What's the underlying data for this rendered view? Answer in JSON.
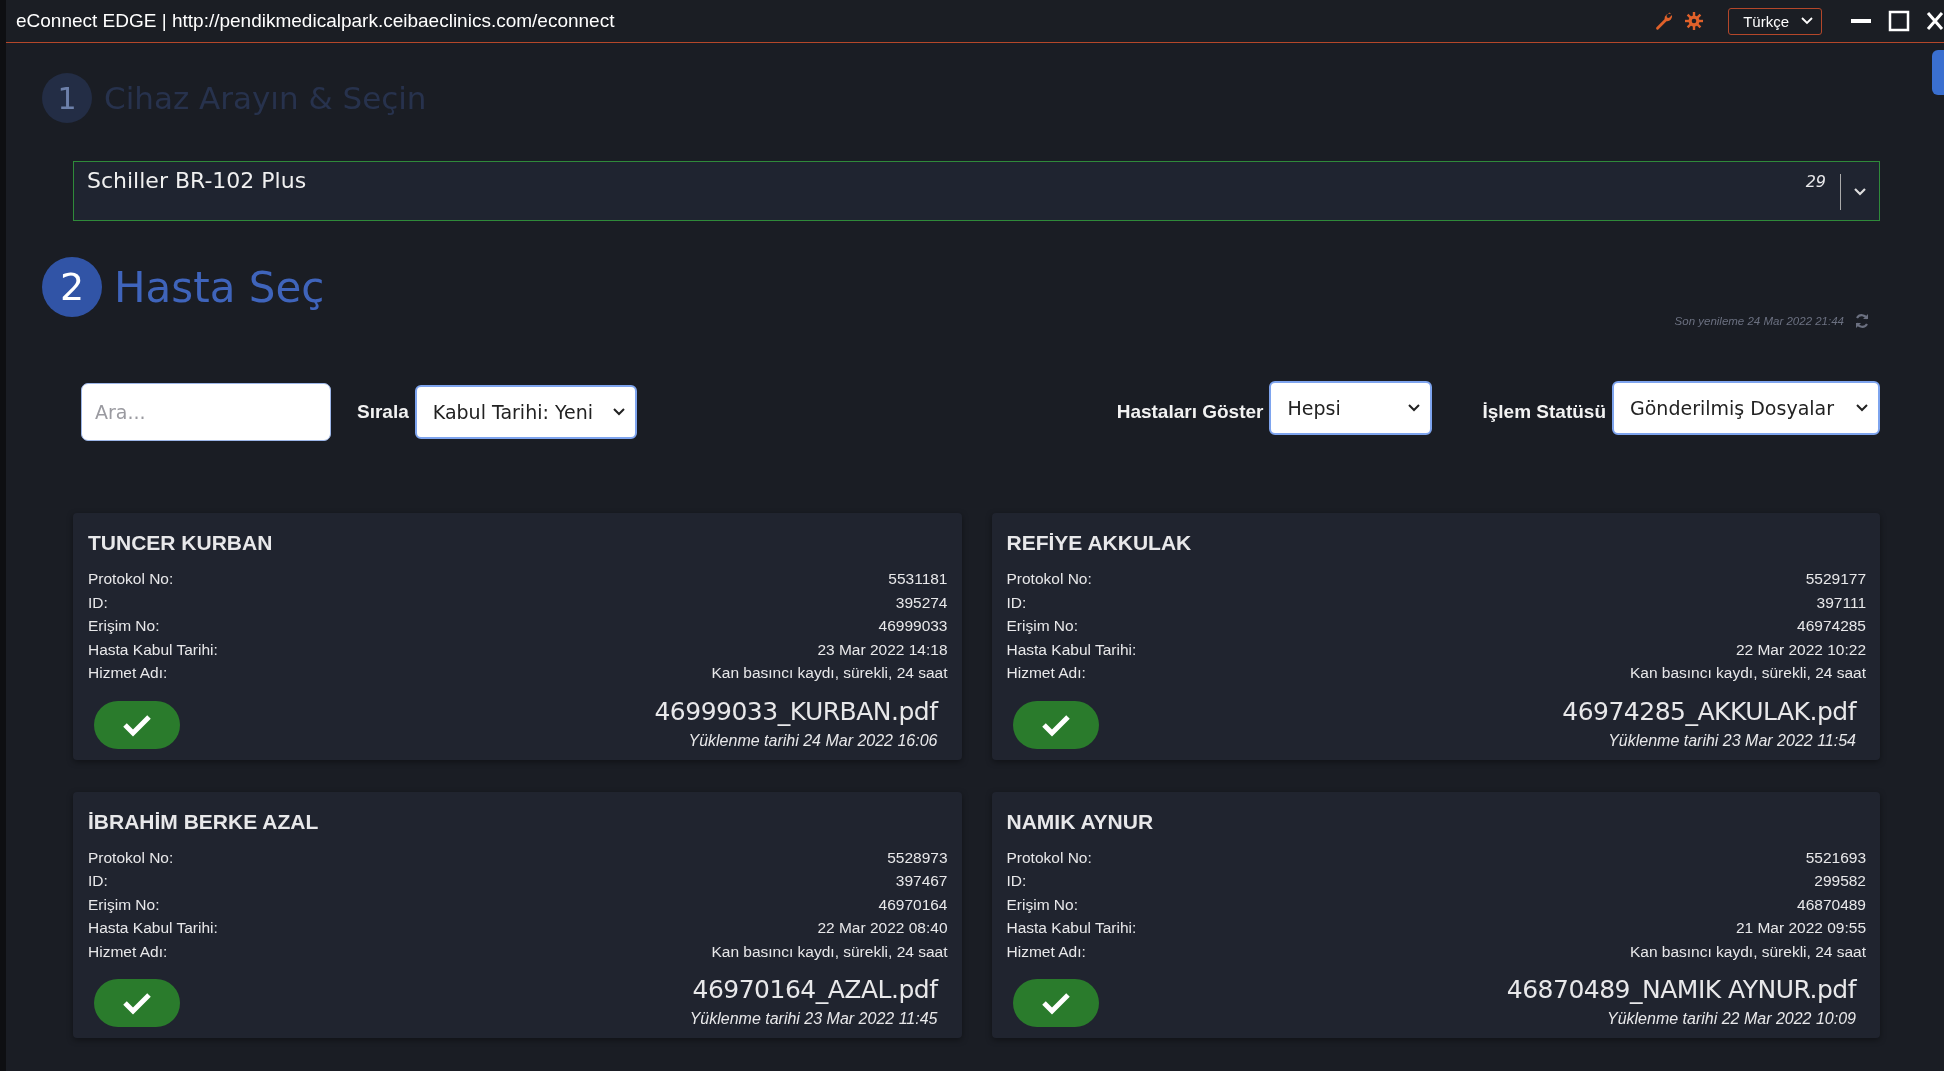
{
  "window": {
    "title": "eConnect EDGE | http://pendikmedicalpark.ceibaeclinics.com/econnect",
    "language": "Türkçe"
  },
  "steps": [
    {
      "number": "1",
      "title": "Cihaz Arayın & Seçin",
      "active": false
    },
    {
      "number": "2",
      "title": "Hasta Seç",
      "active": true
    }
  ],
  "device_select": {
    "value": "Schiller BR-102 Plus",
    "count": "29"
  },
  "last_refresh": "Son yenileme 24 Mar 2022 21:44",
  "filters": {
    "search_placeholder": "Ara...",
    "sort_label": "Sırala",
    "sort_value": "Kabul Tarihi: Yeni",
    "show_label": "Hastaları Göster",
    "show_value": "Hepsi",
    "status_label": "İşlem Statüsü",
    "status_value": "Gönderilmiş Dosyalar"
  },
  "patients": [
    {
      "name": "TUNCER KURBAN",
      "fields": [
        {
          "label": "Protokol No:",
          "value": "5531181"
        },
        {
          "label": "ID:",
          "value": "395274"
        },
        {
          "label": "Erişim No:",
          "value": "46999033"
        },
        {
          "label": "Hasta Kabul Tarihi:",
          "value": "23 Mar 2022 14:18"
        },
        {
          "label": "Hizmet Adı:",
          "value": "Kan basıncı kaydı, sürekli, 24 saat"
        }
      ],
      "sent": true,
      "file": "46999033_KURBAN.pdf",
      "uploaded": "Yüklenme tarihi 24 Mar 2022 16:06"
    },
    {
      "name": "REFİYE AKKULAK",
      "fields": [
        {
          "label": "Protokol No:",
          "value": "5529177"
        },
        {
          "label": "ID:",
          "value": "397111"
        },
        {
          "label": "Erişim No:",
          "value": "46974285"
        },
        {
          "label": "Hasta Kabul Tarihi:",
          "value": "22 Mar 2022 10:22"
        },
        {
          "label": "Hizmet Adı:",
          "value": "Kan basıncı kaydı, sürekli, 24 saat"
        }
      ],
      "sent": true,
      "file": "46974285_AKKULAK.pdf",
      "uploaded": "Yüklenme tarihi 23 Mar 2022 11:54"
    },
    {
      "name": "İBRAHİM BERKE AZAL",
      "fields": [
        {
          "label": "Protokol No:",
          "value": "5528973"
        },
        {
          "label": "ID:",
          "value": "397467"
        },
        {
          "label": "Erişim No:",
          "value": "46970164"
        },
        {
          "label": "Hasta Kabul Tarihi:",
          "value": "22 Mar 2022 08:40"
        },
        {
          "label": "Hizmet Adı:",
          "value": "Kan basıncı kaydı, sürekli, 24 saat"
        }
      ],
      "sent": true,
      "file": "46970164_AZAL.pdf",
      "uploaded": "Yüklenme tarihi 23 Mar 2022 11:45"
    },
    {
      "name": "NAMIK AYNUR",
      "fields": [
        {
          "label": "Protokol No:",
          "value": "5521693"
        },
        {
          "label": "ID:",
          "value": "299582"
        },
        {
          "label": "Erişim No:",
          "value": "46870489"
        },
        {
          "label": "Hasta Kabul Tarihi:",
          "value": "21 Mar 2022 09:55"
        },
        {
          "label": "Hizmet Adı:",
          "value": "Kan basıncı kaydı, sürekli, 24 saat"
        }
      ],
      "sent": true,
      "file": "46870489_NAMIK AYNUR.pdf",
      "uploaded": "Yüklenme tarihi 22 Mar 2022 10:09"
    }
  ]
}
